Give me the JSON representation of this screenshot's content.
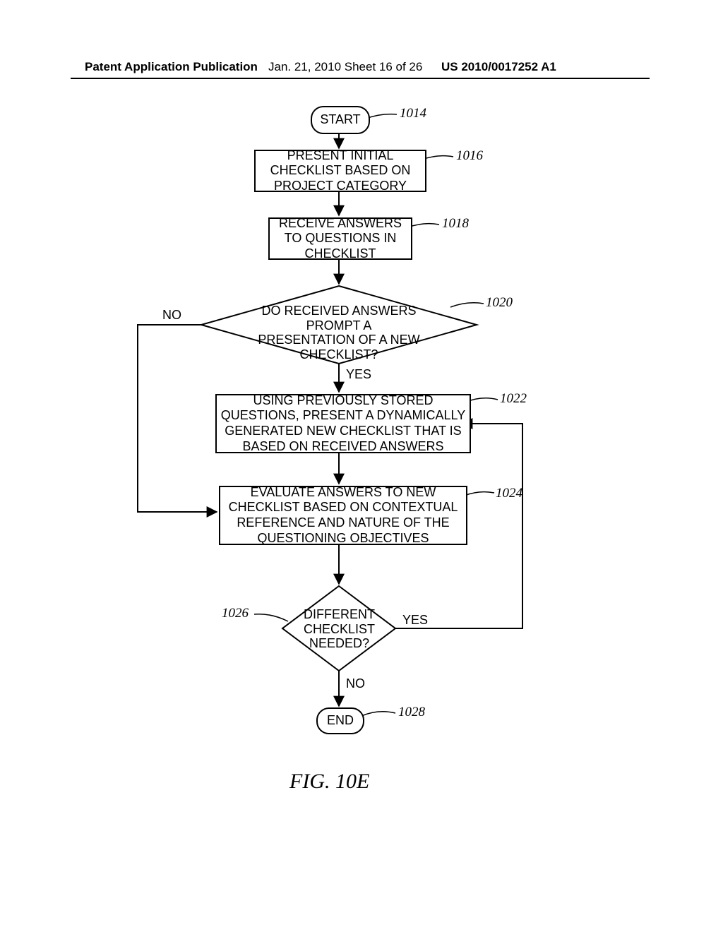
{
  "header": {
    "left": "Patent Application Publication",
    "center": "Jan. 21, 2010  Sheet 16 of 26",
    "right": "US 2010/0017252 A1"
  },
  "nodes": {
    "start": {
      "text": "START",
      "ref": "1014"
    },
    "present_initial": {
      "text": "PRESENT INITIAL CHECKLIST BASED ON PROJECT CATEGORY",
      "ref": "1016"
    },
    "receive_answers": {
      "text": "RECEIVE ANSWERS TO QUESTIONS IN CHECKLIST",
      "ref": "1018"
    },
    "decision_prompt": {
      "text": "DO RECEIVED ANSWERS PROMPT A PRESENTATION OF A NEW CHECKLIST?",
      "ref": "1020"
    },
    "present_new": {
      "text": "USING PREVIOUSLY STORED QUESTIONS, PRESENT A DYNAMICALLY GENERATED NEW CHECKLIST THAT IS BASED ON RECEIVED ANSWERS",
      "ref": "1022"
    },
    "evaluate": {
      "text": "EVALUATE ANSWERS TO NEW CHECKLIST BASED ON CONTEXTUAL REFERENCE AND NATURE OF THE QUESTIONING OBJECTIVES",
      "ref": "1024"
    },
    "decision_diff": {
      "text": "DIFFERENT CHECKLIST NEEDED?",
      "ref": "1026"
    },
    "end": {
      "text": "END",
      "ref": "1028"
    }
  },
  "edges": {
    "no": "NO",
    "yes": "YES"
  },
  "figure_caption": "FIG. 10E"
}
